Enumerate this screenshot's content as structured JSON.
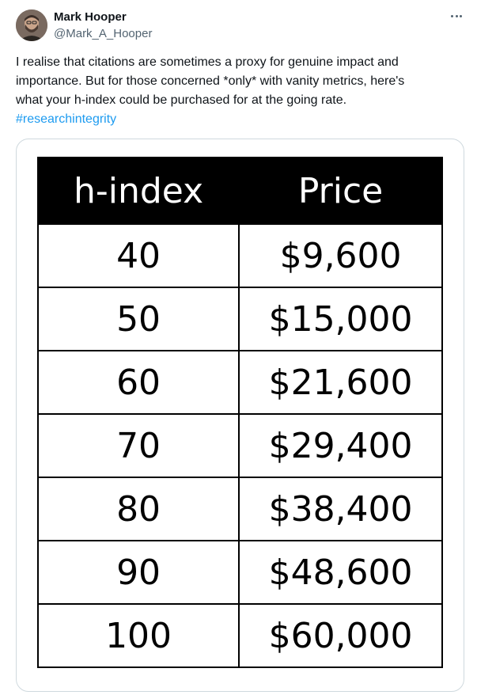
{
  "author": {
    "name": "Mark Hooper",
    "handle": "@Mark_A_Hooper"
  },
  "tweet": {
    "line1": "I realise that citations are sometimes a proxy for genuine impact and",
    "line2": "importance.  But for those concerned *only* with vanity metrics, here's",
    "line3": "what your h-index could be purchased for at the going rate.",
    "hashtag": "#researchintegrity"
  },
  "table": {
    "headers": [
      "h-index",
      "Price"
    ],
    "rows": [
      {
        "h_index": "40",
        "price": "$9,600"
      },
      {
        "h_index": "50",
        "price": "$15,000"
      },
      {
        "h_index": "60",
        "price": "$21,600"
      },
      {
        "h_index": "70",
        "price": "$29,400"
      },
      {
        "h_index": "80",
        "price": "$38,400"
      },
      {
        "h_index": "90",
        "price": "$48,600"
      },
      {
        "h_index": "100",
        "price": "$60,000"
      }
    ]
  },
  "icons": {
    "avatar": "avatar",
    "more": "more-icon"
  },
  "colors": {
    "text": "#0f1419",
    "secondary": "#536471",
    "link": "#1d9bf0",
    "card_border": "#cfd9de",
    "table_header_bg": "#000000",
    "table_header_text": "#ffffff"
  }
}
